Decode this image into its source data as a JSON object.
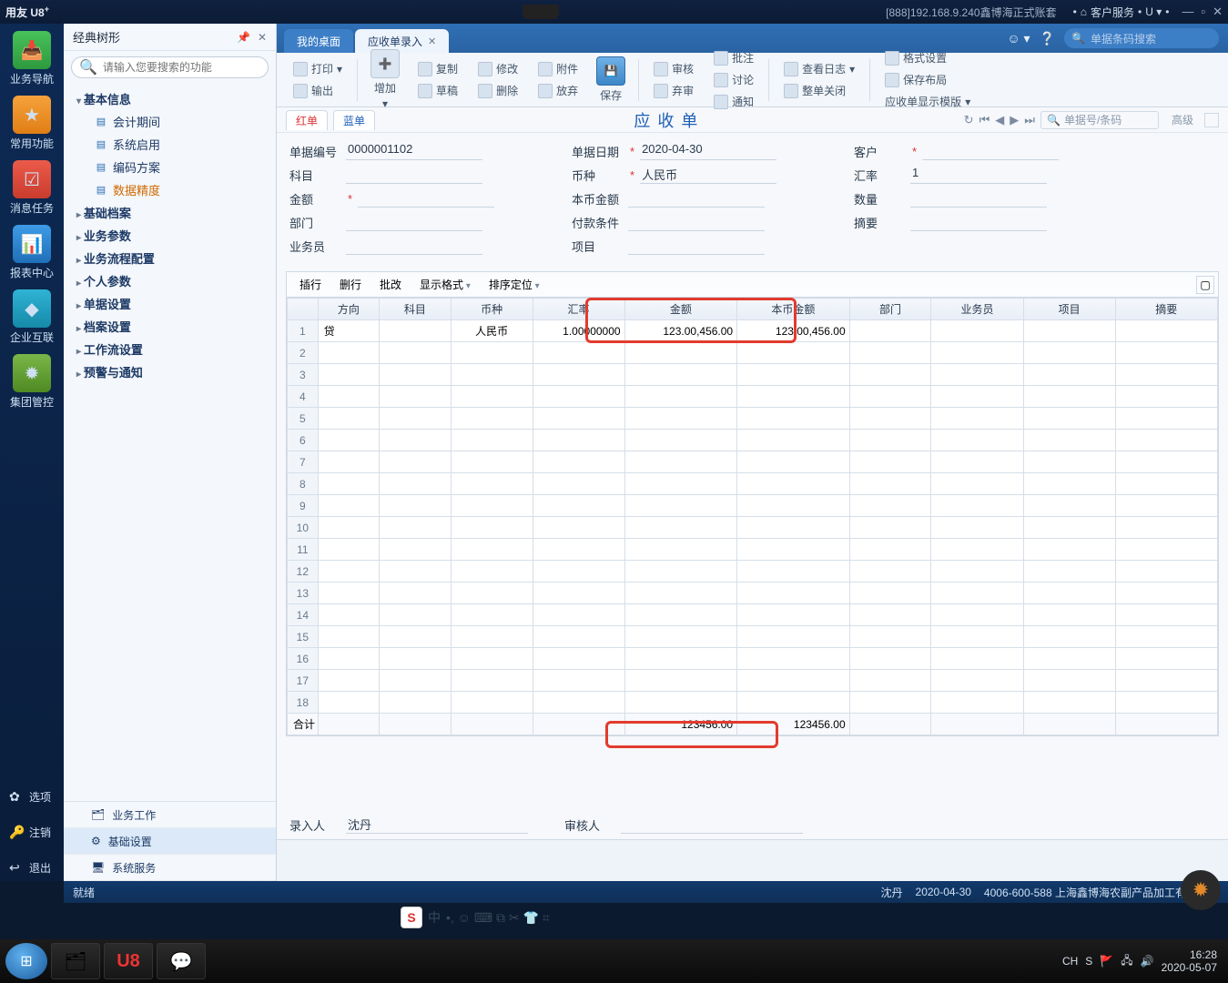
{
  "titlebar": {
    "product": "用友 U8",
    "product_sup": "+",
    "connection": "[888]192.168.9.240鑫博海正式账套",
    "service": "客户服务",
    "service_u": "U ▾"
  },
  "rail": {
    "items": [
      {
        "key": "nav",
        "label": "业务导航"
      },
      {
        "key": "star",
        "label": "常用功能"
      },
      {
        "key": "msg",
        "label": "消息任务"
      },
      {
        "key": "rep",
        "label": "报表中心"
      },
      {
        "key": "ent",
        "label": "企业互联"
      },
      {
        "key": "grp",
        "label": "集团管控"
      }
    ],
    "options": [
      {
        "key": "opt",
        "label": "选项",
        "icon": "✿"
      },
      {
        "key": "relogin",
        "label": "注销",
        "icon": "🔑"
      },
      {
        "key": "exit",
        "label": "退出",
        "icon": "↩"
      }
    ]
  },
  "sidebar": {
    "title": "经典树形",
    "search_placeholder": "请输入您要搜索的功能",
    "group_open": "基本信息",
    "leaves": [
      {
        "label": "会计期间"
      },
      {
        "label": "系统启用"
      },
      {
        "label": "编码方案"
      },
      {
        "label": "数据精度",
        "active": true
      }
    ],
    "groups_collapsed": [
      "基础档案",
      "业务参数",
      "业务流程配置",
      "个人参数",
      "单据设置",
      "档案设置",
      "工作流设置",
      "预警与通知"
    ],
    "footer": [
      {
        "label": "业务工作"
      },
      {
        "label": "基础设置",
        "active": true
      },
      {
        "label": "系统服务"
      }
    ]
  },
  "tabs": {
    "home": "我的桌面",
    "current": "应收单录入",
    "search_placeholder": "单据条码搜索"
  },
  "ribbon": {
    "print": "打印",
    "export": "输出",
    "add": "增加",
    "copy": "复制",
    "draft": "草稿",
    "modify": "修改",
    "delete": "删除",
    "attach": "附件",
    "abandon": "放弃",
    "save": "保存",
    "audit": "审核",
    "unaudit": "弃审",
    "approve": "批注",
    "discuss": "讨论",
    "notify": "通知",
    "log": "查看日志",
    "close": "整单关闭",
    "format": "格式设置",
    "layout": "保存布局",
    "template": "应收单显示模版"
  },
  "docbar": {
    "red": "红单",
    "blue": "蓝单",
    "title": "应收单",
    "locate_placeholder": "单据号/条码",
    "adv": "高级"
  },
  "form": {
    "doc_no_lbl": "单据编号",
    "doc_no": "0000001102",
    "date_lbl": "单据日期",
    "date": "2020-04-30",
    "cust_lbl": "客户",
    "subj_lbl": "科目",
    "curr_lbl": "币种",
    "curr": "人民币",
    "rate_lbl": "汇率",
    "rate": "1",
    "amt_lbl": "金额",
    "local_amt_lbl": "本币金额",
    "qty_lbl": "数量",
    "dept_lbl": "部门",
    "payterm_lbl": "付款条件",
    "digest_lbl": "摘要",
    "sales_lbl": "业务员",
    "proj_lbl": "项目"
  },
  "gridbar": {
    "ins": "插行",
    "del": "删行",
    "batch": "批改",
    "disp": "显示格式",
    "sort": "排序定位"
  },
  "grid": {
    "headers": [
      "方向",
      "科目",
      "币种",
      "汇率",
      "金额",
      "本币金额",
      "部门",
      "业务员",
      "项目",
      "摘要"
    ],
    "row1": {
      "dir": "贷",
      "curr": "人民币",
      "rate": "1.00000000",
      "amt": "123.00,456.00",
      "local": "123.00,456.00"
    },
    "sum_label": "合计",
    "sum_amt": "123456.00",
    "sum_local": "123456.00"
  },
  "footer": {
    "entry_lbl": "录入人",
    "entry": "沈丹",
    "audit_lbl": "审核人"
  },
  "appstatus": {
    "ready": "就绪",
    "user": "沈丹",
    "date": "2020-04-30",
    "hotline": "4006-600-588 上海鑫博海农副产品加工有限公司"
  },
  "ime": {
    "lang": "中",
    "icons": "•, ☺ ⌨ ⧉ ✂ 👕 ⌗"
  },
  "taskbar": {
    "tray_text": "CH",
    "time": "16:28",
    "date": "2020-05-07"
  }
}
